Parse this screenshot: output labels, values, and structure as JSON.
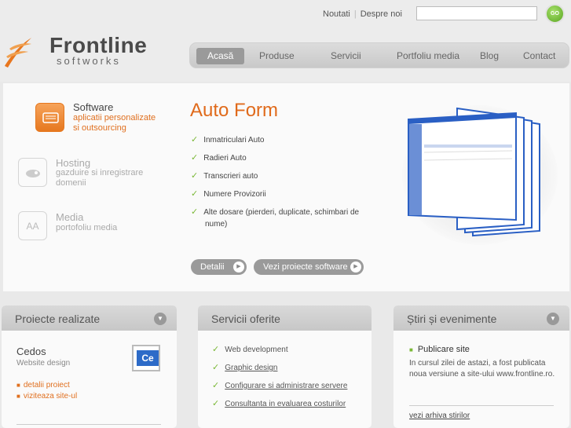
{
  "header": {
    "top_links": [
      "Noutati",
      "Despre noi"
    ],
    "search": {
      "value": "",
      "placeholder": ""
    },
    "go_label": "GO",
    "brand": {
      "name": "Frontline",
      "tagline": "softworks"
    }
  },
  "nav": {
    "items": [
      "Acasă",
      "Produse",
      "Servicii",
      "Portfoliu media",
      "Blog",
      "Contact"
    ],
    "active": "Acasă"
  },
  "sidebar": {
    "items": [
      {
        "title": "Software",
        "desc": [
          "aplicatii personalizate",
          "si outsourcing"
        ],
        "active": true
      },
      {
        "title": "Hosting",
        "desc": [
          "gazduire si inregistrare",
          "domenii"
        ],
        "active": false
      },
      {
        "title": "Media",
        "desc": [
          "portofoliu media"
        ],
        "active": false,
        "icon_text": "AA"
      }
    ]
  },
  "feature": {
    "title": "Auto Form",
    "items": [
      "Inmatriculari Auto",
      "Radieri Auto",
      "Transcrieri auto",
      "Numere Provizorii",
      "Alte dosare (pierderi, duplicate, schimbari de nume)"
    ],
    "buttons": [
      "Detalii",
      "Vezi proiecte software"
    ]
  },
  "boxes": {
    "projects": {
      "title": "Proiecte realizate",
      "name": "Cedos",
      "type": "Website design",
      "logo_text": "Ce",
      "links": [
        "detalii proiect",
        "viziteaza site-ul"
      ]
    },
    "services": {
      "title": "Servicii oferite",
      "items": [
        "Web development",
        "Graphic design",
        "Configurare si administrare servere",
        "Consultanta in evaluarea costurilor"
      ]
    },
    "news": {
      "title": "Știri și evenimente",
      "headline": "Publicare site",
      "body": [
        "In cursul zilei de astazi, a fost publicata",
        "noua versiune a site-ului www.frontline.ro."
      ],
      "archive": "vezi arhiva stirilor"
    }
  },
  "colors": {
    "accent_orange": "#e06a1b",
    "check_green": "#7ab836",
    "go_green": "#6bbf2f"
  }
}
